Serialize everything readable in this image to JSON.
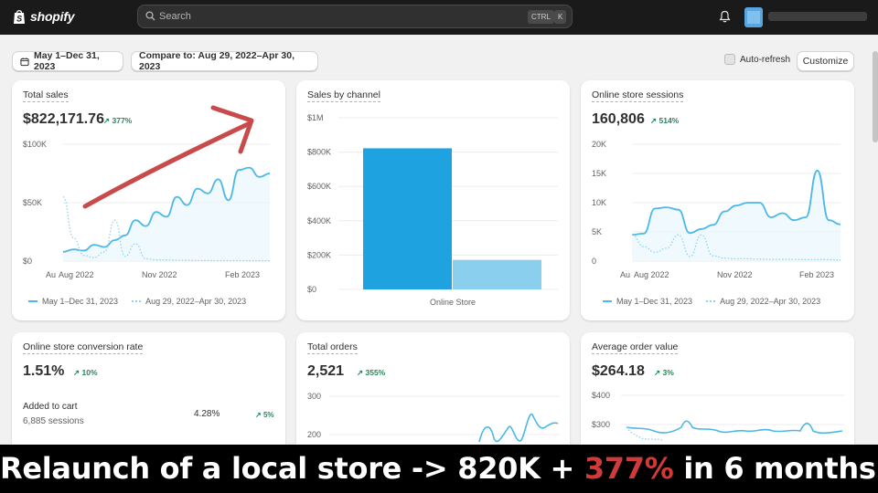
{
  "app": {
    "brand": "shopify"
  },
  "search": {
    "placeholder": "Search",
    "kbd_ctrl": "CTRL",
    "kbd_k": "K"
  },
  "toolbar": {
    "date_range": "May 1–Dec 31, 2023",
    "compare": "Compare to: Aug 29, 2022–Apr 30, 2023",
    "auto_refresh": "Auto-refresh",
    "customize": "Customize"
  },
  "colors": {
    "primary_series": "#4ab8e8",
    "comparison_series": "#8fd3f0",
    "positive": "#29845a",
    "annotation_arrow": "#c94a4a",
    "caption_highlight": "#d13a3a"
  },
  "cards": {
    "total_sales": {
      "title": "Total sales",
      "value": "$822,171.76",
      "delta": "377%",
      "yticks": [
        "$100K",
        "$50K",
        "$0"
      ],
      "xticks": [
        "Au",
        "Aug 2022",
        "Nov 2022",
        "Feb 2023"
      ],
      "legend_current": "May 1–Dec 31, 2023",
      "legend_compare": "Aug 29, 2022–Apr 30, 2023"
    },
    "sales_by_channel": {
      "title": "Sales by channel",
      "yticks": [
        "$1M",
        "$800K",
        "$600K",
        "$400K",
        "$200K",
        "$0"
      ],
      "xlabel": "Online Store"
    },
    "sessions": {
      "title": "Online store sessions",
      "value": "160,806",
      "delta": "514%",
      "yticks": [
        "20K",
        "15K",
        "10K",
        "5K",
        "0"
      ],
      "xticks": [
        "Au",
        "Aug 2022",
        "Nov 2022",
        "Feb 2023"
      ],
      "legend_current": "May 1–Dec 31, 2023",
      "legend_compare": "Aug 29, 2022–Apr 30, 2023"
    },
    "conversion": {
      "title": "Online store conversion rate",
      "value": "1.51%",
      "delta": "10%",
      "row_label": "Added to cart",
      "row_sub": "6,885 sessions",
      "row_value": "4.28%",
      "row_delta": "5%"
    },
    "orders": {
      "title": "Total orders",
      "value": "2,521",
      "delta": "355%",
      "yticks": [
        "300",
        "200"
      ]
    },
    "aov": {
      "title": "Average order value",
      "value": "$264.18",
      "delta": "3%",
      "yticks": [
        "$400",
        "$300"
      ]
    }
  },
  "caption": {
    "part1": "Relaunch of a local store -> 820K + ",
    "highlight": "377%",
    "part2": " in 6 months!"
  },
  "chart_data": [
    {
      "type": "line",
      "title": "Total sales",
      "ylim": [
        0,
        100000
      ],
      "series": [
        {
          "name": "May 1–Dec 31, 2023",
          "values": [
            8000,
            10000,
            9000,
            14000,
            12000,
            18000,
            22000,
            35000,
            30000,
            42000,
            38000,
            55000,
            48000,
            62000,
            58000,
            70000,
            52000,
            78000,
            80000,
            72000,
            75000
          ]
        },
        {
          "name": "Aug 29, 2022–Apr 30, 2023",
          "values": [
            55000,
            20000,
            5000,
            3000,
            8000,
            35000,
            4000,
            15000,
            2000,
            1000,
            1000,
            800,
            600,
            500,
            500,
            400,
            400,
            400,
            300,
            300,
            300
          ]
        }
      ]
    },
    {
      "type": "bar",
      "title": "Sales by channel",
      "categories": [
        "Online Store"
      ],
      "ylim": [
        0,
        1000000
      ],
      "series": [
        {
          "name": "May 1–Dec 31, 2023",
          "values": [
            822172
          ]
        },
        {
          "name": "Aug 29, 2022–Apr 30, 2023",
          "values": [
            172000
          ]
        }
      ]
    },
    {
      "type": "line",
      "title": "Online store sessions",
      "ylim": [
        0,
        20000
      ],
      "series": [
        {
          "name": "May 1–Dec 31, 2023",
          "values": [
            4500,
            4700,
            9000,
            9200,
            8800,
            4800,
            5500,
            6200,
            8500,
            9500,
            10000,
            10000,
            7500,
            8200,
            7000,
            7500,
            15500,
            7000,
            6300
          ]
        },
        {
          "name": "Aug 29, 2022–Apr 30, 2023",
          "values": [
            4500,
            2500,
            1500,
            2200,
            4500,
            800,
            4500,
            900,
            500,
            400,
            400,
            350,
            300,
            300,
            300,
            250,
            250,
            250,
            200
          ]
        }
      ]
    }
  ]
}
